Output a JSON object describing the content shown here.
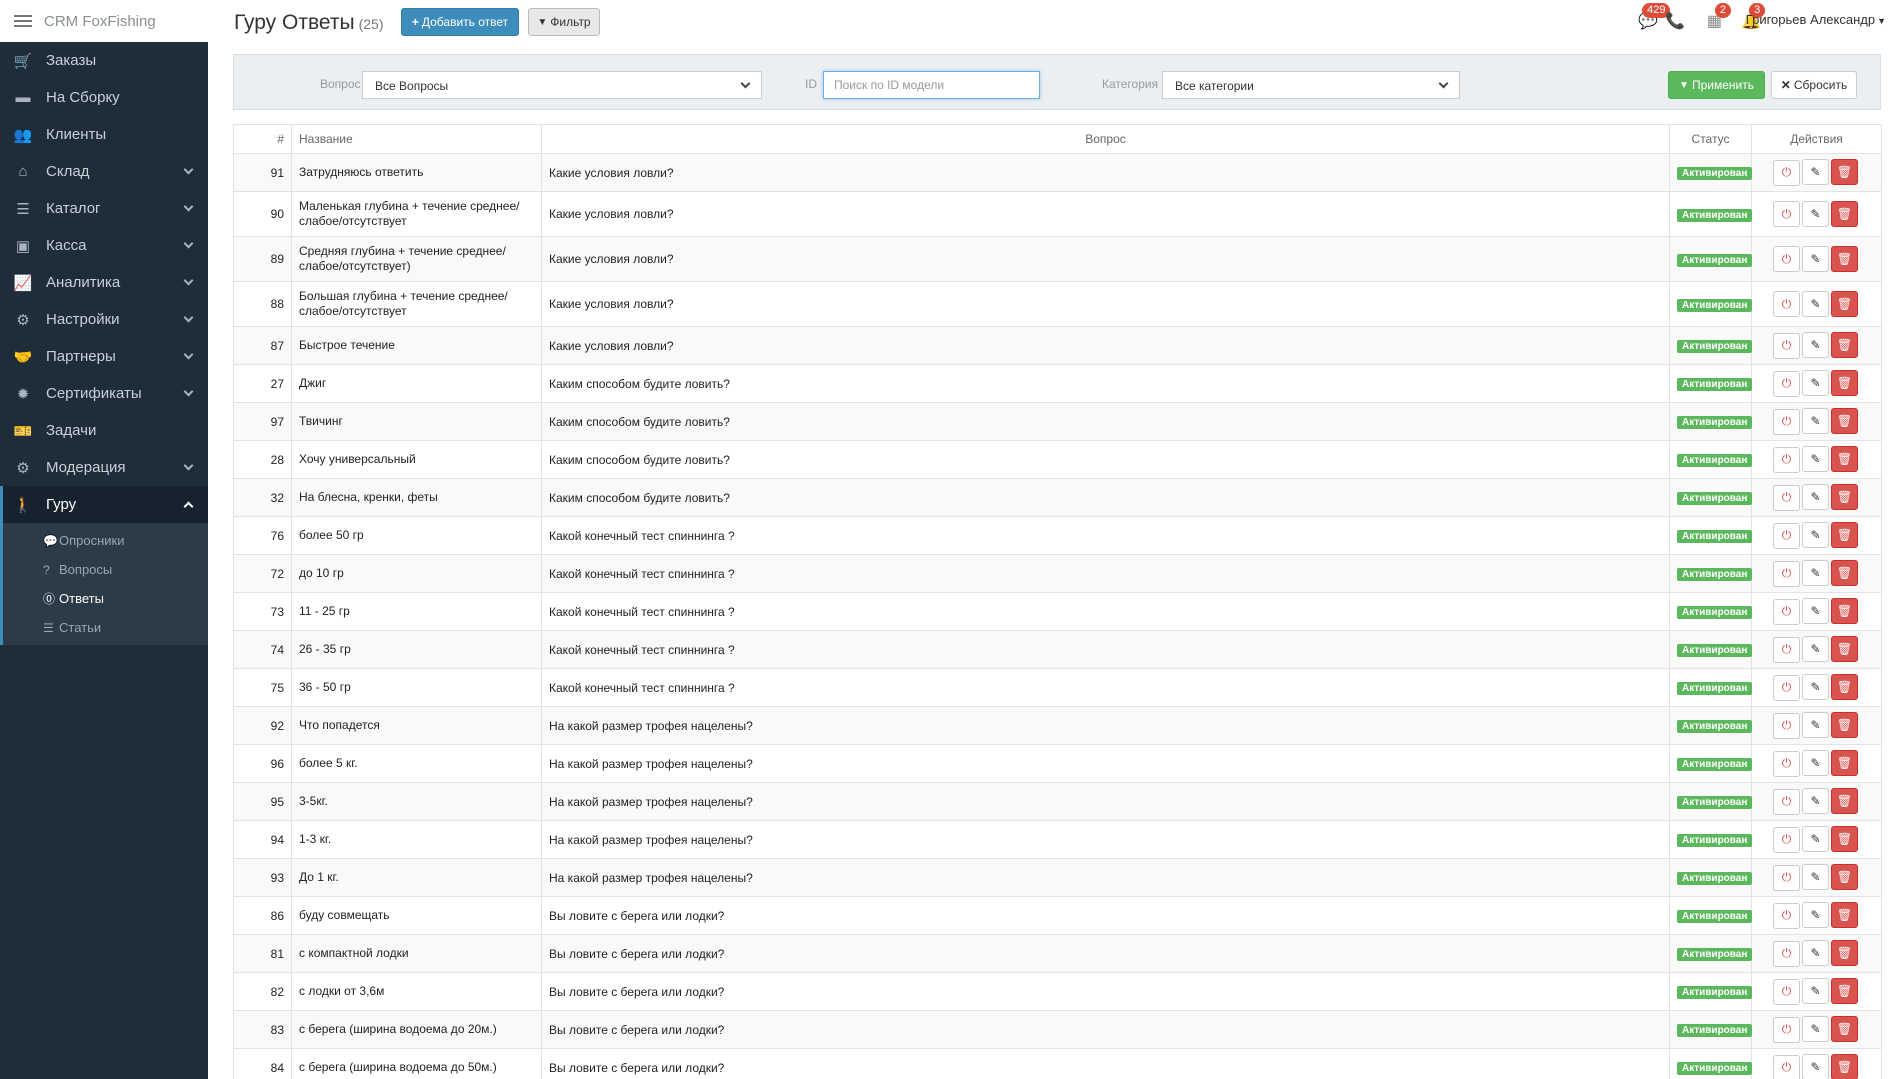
{
  "brand": "CRM FoxFishing",
  "nav": [
    {
      "label": "Заказы",
      "icon": "cart-icon",
      "glyph": "🛒",
      "chevron": false
    },
    {
      "label": "На Сборку",
      "icon": "inbox-icon",
      "glyph": "▬",
      "chevron": false
    },
    {
      "label": "Клиенты",
      "icon": "users-icon",
      "glyph": "👥",
      "chevron": false
    },
    {
      "label": "Склад",
      "icon": "home-icon",
      "glyph": "⌂",
      "chevron": true
    },
    {
      "label": "Каталог",
      "icon": "list-icon",
      "glyph": "☰",
      "chevron": true
    },
    {
      "label": "Касса",
      "icon": "money-icon",
      "glyph": "▣",
      "chevron": true
    },
    {
      "label": "Аналитика",
      "icon": "chart-icon",
      "glyph": "📈",
      "chevron": true
    },
    {
      "label": "Настройки",
      "icon": "gears-icon",
      "glyph": "⚙",
      "chevron": true
    },
    {
      "label": "Партнеры",
      "icon": "handshake-icon",
      "glyph": "🤝",
      "chevron": true
    },
    {
      "label": "Сертификаты",
      "icon": "certificate-icon",
      "glyph": "✹",
      "chevron": true
    },
    {
      "label": "Задачи",
      "icon": "ticket-icon",
      "glyph": "🎫",
      "chevron": false
    },
    {
      "label": "Модерация",
      "icon": "gears-icon",
      "glyph": "⚙",
      "chevron": true
    },
    {
      "label": "Гуру",
      "icon": "walking-icon",
      "glyph": "🚶",
      "chevron": true,
      "active": true
    }
  ],
  "submenu": [
    {
      "label": "Опросники",
      "icon": "comments-icon",
      "glyph": "💬"
    },
    {
      "label": "Вопросы",
      "icon": "question-icon",
      "glyph": "?"
    },
    {
      "label": "Ответы",
      "icon": "question-circle-icon",
      "glyph": "⓪",
      "current": true
    },
    {
      "label": "Статьи",
      "icon": "list-icon",
      "glyph": "☰"
    }
  ],
  "header": {
    "title": "Гуру Ответы",
    "count": "(25)",
    "add_label": "Добавить ответ",
    "filter_label": "Фильтр",
    "messages_badge": "429",
    "calendar_badge": "2",
    "bell_badge": "3",
    "user": "Григорьев Александр"
  },
  "filters": {
    "question_label": "Вопрос",
    "question_value": "Все Вопросы",
    "id_label": "ID",
    "id_placeholder": "Поиск по ID модели",
    "category_label": "Категория",
    "category_value": "Все категории",
    "apply_label": "Применить",
    "reset_label": "Сбросить"
  },
  "table": {
    "columns": [
      "#",
      "Название",
      "Вопрос",
      "Статус",
      "Действия"
    ],
    "rows": [
      {
        "id": "91",
        "name": "Затрудняюсь ответить",
        "question": "Какие условия ловли?",
        "status": "Активирован"
      },
      {
        "id": "90",
        "name": "Маленькая глубина + течение среднее/слабое/отсутствует",
        "question": "Какие условия ловли?",
        "status": "Активирован",
        "tall": true
      },
      {
        "id": "89",
        "name": "Средняя глубина + течение среднее/слабое/отсутствует)",
        "question": "Какие условия ловли?",
        "status": "Активирован",
        "tall": true
      },
      {
        "id": "88",
        "name": "Большая глубина + течение среднее/слабое/отсутствует",
        "question": "Какие условия ловли?",
        "status": "Активирован",
        "tall": true
      },
      {
        "id": "87",
        "name": "Быстрое течение",
        "question": "Какие условия ловли?",
        "status": "Активирован"
      },
      {
        "id": "27",
        "name": "Джиг",
        "question": "Каким способом будите ловить?",
        "status": "Активирован"
      },
      {
        "id": "97",
        "name": "Твичинг",
        "question": "Каким способом будите ловить?",
        "status": "Активирован"
      },
      {
        "id": "28",
        "name": "Хочу универсальный",
        "question": "Каким способом будите ловить?",
        "status": "Активирован"
      },
      {
        "id": "32",
        "name": "На блесна, кренки, феты",
        "question": "Каким способом будите ловить?",
        "status": "Активирован"
      },
      {
        "id": "76",
        "name": "более 50 гр",
        "question": "Какой конечный тест спиннинга ?",
        "status": "Активирован"
      },
      {
        "id": "72",
        "name": "до 10 гр",
        "question": "Какой конечный тест спиннинга ?",
        "status": "Активирован"
      },
      {
        "id": "73",
        "name": "11 - 25 гр",
        "question": "Какой конечный тест спиннинга ?",
        "status": "Активирован"
      },
      {
        "id": "74",
        "name": "26 - 35 гр",
        "question": "Какой конечный тест спиннинга ?",
        "status": "Активирован"
      },
      {
        "id": "75",
        "name": "36 - 50 гр",
        "question": "Какой конечный тест спиннинга ?",
        "status": "Активирован"
      },
      {
        "id": "92",
        "name": "Что попадется",
        "question": "На какой размер трофея нацелены?",
        "status": "Активирован"
      },
      {
        "id": "96",
        "name": "более 5 кг.",
        "question": "На какой размер трофея нацелены?",
        "status": "Активирован"
      },
      {
        "id": "95",
        "name": "3-5кг.",
        "question": "На какой размер трофея нацелены?",
        "status": "Активирован"
      },
      {
        "id": "94",
        "name": "1-3 кг.",
        "question": "На какой размер трофея нацелены?",
        "status": "Активирован"
      },
      {
        "id": "93",
        "name": "До 1 кг.",
        "question": "На какой размер трофея нацелены?",
        "status": "Активирован"
      },
      {
        "id": "86",
        "name": "буду совмещать",
        "question": "Вы ловите с берега или лодки?",
        "status": "Активирован"
      },
      {
        "id": "81",
        "name": "с компактной лодки",
        "question": "Вы ловите с берега или лодки?",
        "status": "Активирован"
      },
      {
        "id": "82",
        "name": "с лодки от 3,6м",
        "question": "Вы ловите с берега или лодки?",
        "status": "Активирован"
      },
      {
        "id": "83",
        "name": "с берега (ширина водоема до 20м.)",
        "question": "Вы ловите с берега или лодки?",
        "status": "Активирован"
      },
      {
        "id": "84",
        "name": "с берега (ширина водоема до 50м.)",
        "question": "Вы ловите с берега или лодки?",
        "status": "Активирован"
      }
    ]
  }
}
